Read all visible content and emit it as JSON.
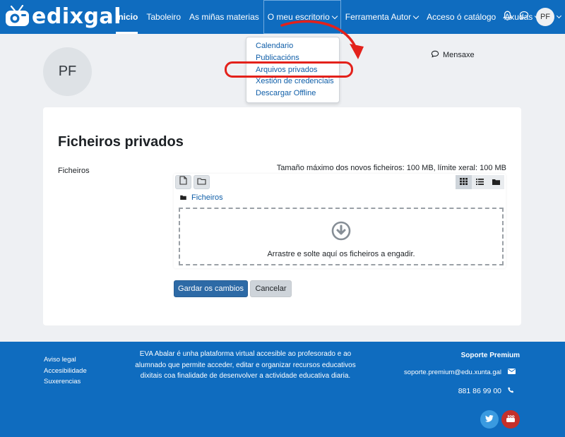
{
  "brand": {
    "name": "edixgal"
  },
  "nav": {
    "items": [
      {
        "label": "Inicio"
      },
      {
        "label": "Taboleiro"
      },
      {
        "label": "As miñas materias"
      },
      {
        "label": "O meu escritorio"
      },
      {
        "label": "Ferramenta Autor"
      },
      {
        "label": "Acceso ó catálogo"
      },
      {
        "label": "Axudas"
      }
    ],
    "user_initials": "PF"
  },
  "dropdown": {
    "items": [
      {
        "label": "Calendario"
      },
      {
        "label": "Publicacións"
      },
      {
        "label": "Arquivos privados"
      },
      {
        "label": "Xestión de credenciais"
      },
      {
        "label": "Descargar Offline"
      }
    ]
  },
  "profile": {
    "initials": "PF",
    "message_label": "Mensaxe"
  },
  "page": {
    "title": "Ficheiros privados",
    "field_label": "Ficheiros",
    "max_size": "Tamaño máximo dos novos ficheiros: 100 MB, límite xeral: 100 MB",
    "path_label": "Ficheiros",
    "drop_text": "Arrastre e solte aquí os ficheiros a engadir.",
    "save_label": "Gardar os cambios",
    "cancel_label": "Cancelar"
  },
  "footer": {
    "links": [
      {
        "label": "Aviso legal"
      },
      {
        "label": "Accesibilidade"
      },
      {
        "label": "Suxerencias"
      }
    ],
    "description": "EVA Abalar é unha plataforma virtual accesible ao profesorado e ao alumnado que permite acceder, editar e organizar recursos educativos dixitais coa finalidade de desenvolver a actividade educativa diaria.",
    "support_title": "Soporte Premium",
    "support_email": "soporte.premium@edu.xunta.gal",
    "support_phone": "881 86 99 00"
  },
  "colors": {
    "brand_blue": "#0f6cbf",
    "highlight_red": "#e3211b",
    "youtube_red": "#c4302b",
    "twitter_blue": "#3a9ae0"
  }
}
